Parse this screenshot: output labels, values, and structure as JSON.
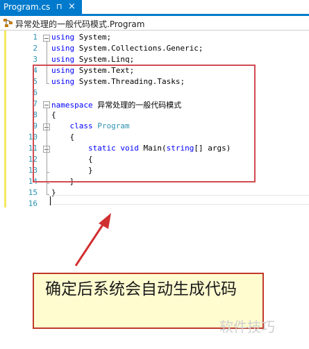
{
  "tab": {
    "title": "Program.cs",
    "pin_glyph": "⊓",
    "close_glyph": "×"
  },
  "navbar": {
    "text": "异常处理的一般代码模式.Program"
  },
  "code": {
    "line_numbers": [
      "1",
      "2",
      "3",
      "4",
      "5",
      "6",
      "7",
      "8",
      "9",
      "10",
      "11",
      "12",
      "13",
      "14",
      "15",
      "16"
    ],
    "lines": [
      [
        {
          "t": "using",
          "c": "kw"
        },
        {
          "t": " System;"
        }
      ],
      [
        {
          "t": "using",
          "c": "kw"
        },
        {
          "t": " System.Collections.Generic;"
        }
      ],
      [
        {
          "t": "using",
          "c": "kw"
        },
        {
          "t": " System.Linq;"
        }
      ],
      [
        {
          "t": "using",
          "c": "kw"
        },
        {
          "t": " System.Text;"
        }
      ],
      [
        {
          "t": "using",
          "c": "kw"
        },
        {
          "t": " System.Threading.Tasks;"
        }
      ],
      [],
      [
        {
          "t": "namespace",
          "c": "kw"
        },
        {
          "t": " 异常处理的一般代码模式"
        }
      ],
      [
        {
          "t": "{"
        }
      ],
      [
        {
          "t": "    "
        },
        {
          "t": "class",
          "c": "kw"
        },
        {
          "t": " "
        },
        {
          "t": "Program",
          "c": "ty"
        }
      ],
      [
        {
          "t": "    {"
        }
      ],
      [
        {
          "t": "        "
        },
        {
          "t": "static",
          "c": "kw"
        },
        {
          "t": " "
        },
        {
          "t": "void",
          "c": "kw"
        },
        {
          "t": " Main("
        },
        {
          "t": "string",
          "c": "kw"
        },
        {
          "t": "[] args)"
        }
      ],
      [
        {
          "t": "        {"
        }
      ],
      [
        {
          "t": "        }"
        }
      ],
      [
        {
          "t": "    }"
        }
      ],
      [
        {
          "t": "}"
        }
      ],
      []
    ]
  },
  "annotation": {
    "text": "确定后系统会自动生成代码"
  },
  "watermark": {
    "text": "软件技巧"
  },
  "colors": {
    "accent": "#007acc",
    "keyword": "#0000ff",
    "type": "#2b91af",
    "highlight_border": "#d04a50",
    "arrow": "#d03030"
  }
}
